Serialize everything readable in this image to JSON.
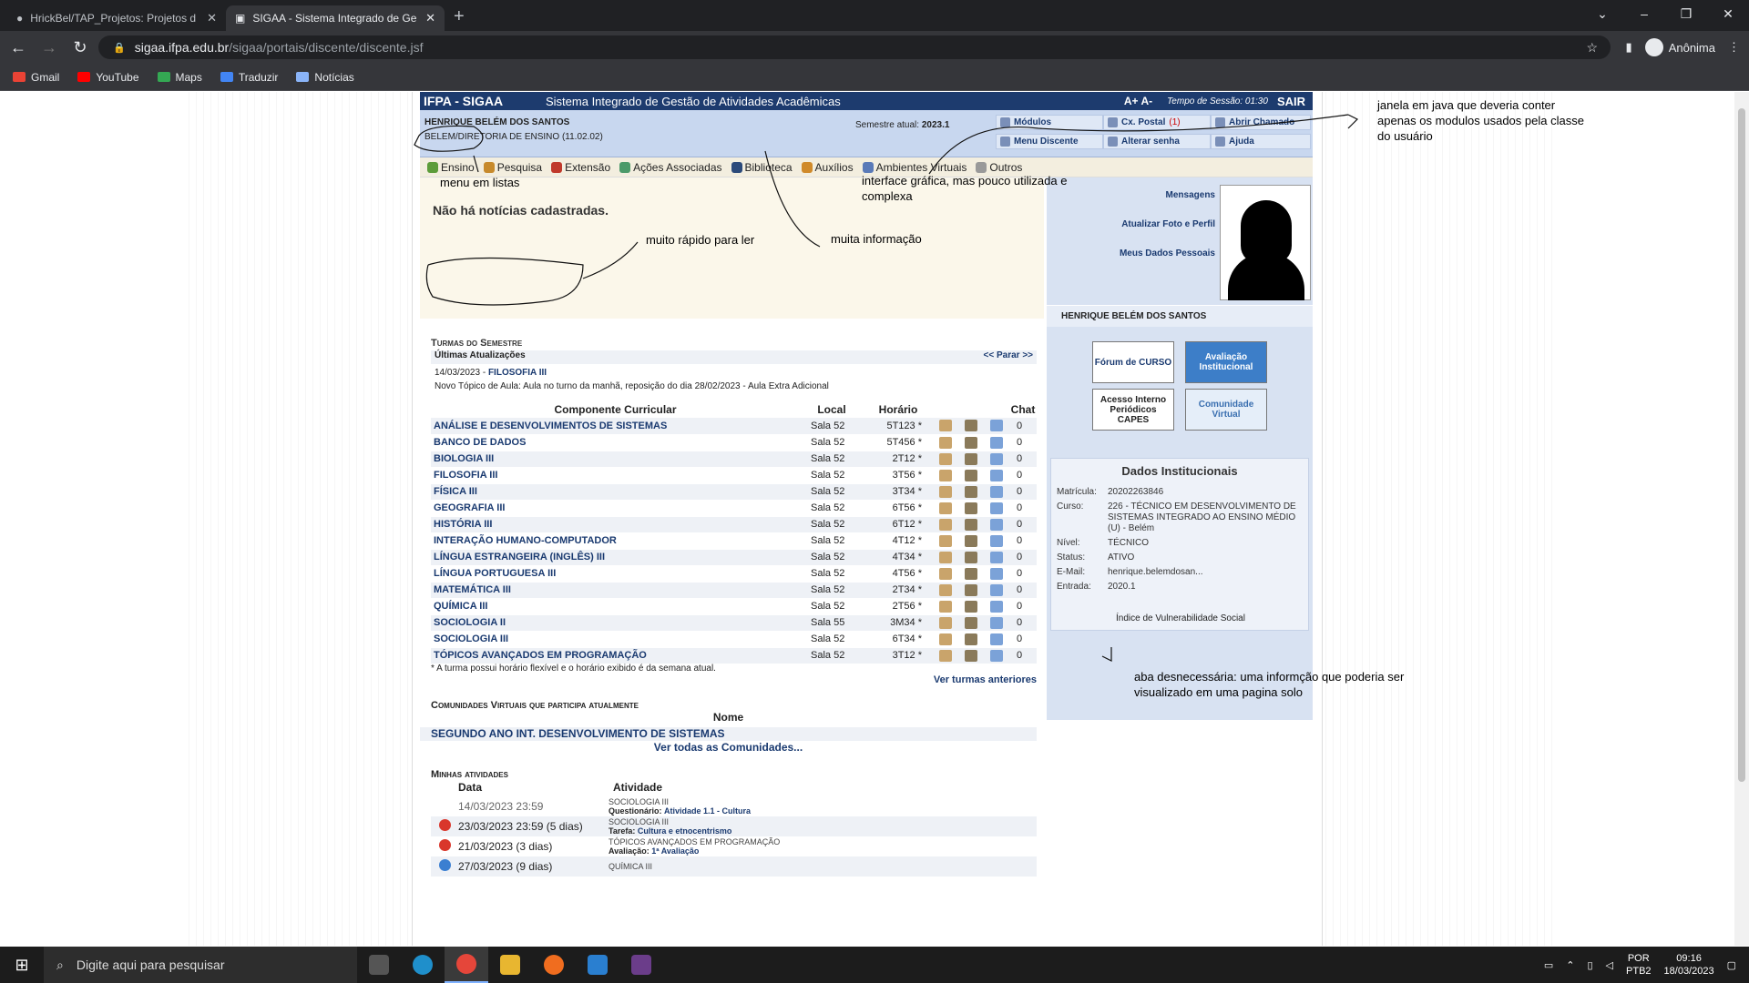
{
  "browser": {
    "tabs": [
      {
        "title": "HrickBel/TAP_Projetos: Projetos d"
      },
      {
        "title": "SIGAA - Sistema Integrado de Ge"
      }
    ],
    "url_host": "sigaa.ifpa.edu.br",
    "url_path": "/sigaa/portais/discente/discente.jsf",
    "profile": "Anônima",
    "bookmarks": [
      {
        "label": "Gmail",
        "color": "#ea4335"
      },
      {
        "label": "YouTube",
        "color": "#ff0000"
      },
      {
        "label": "Maps",
        "color": "#34a853"
      },
      {
        "label": "Traduzir",
        "color": "#4285f4"
      },
      {
        "label": "Notícias",
        "color": "#8ab4f8"
      }
    ]
  },
  "sigaa": {
    "logo": "IFPA - SIGAA",
    "system": "Sistema Integrado de Gestão de Atividades Acadêmicas",
    "font_ctrl": "A+ A-",
    "session": "Tempo de Sessão: 01:30",
    "logout": "SAIR",
    "student": "HENRIQUE BELÉM DOS SANTOS",
    "unit": "BELEM/DIRETORIA DE ENSINO (11.02.02)",
    "semester_label": "Semestre atual:",
    "semester": "2023.1",
    "quick": {
      "modulos": "Módulos",
      "caixa": "Cx. Postal",
      "caixa_count": "(1)",
      "chamado": "Abrir Chamado",
      "menu": "Menu Discente",
      "senha": "Alterar senha",
      "ajuda": "Ajuda"
    },
    "menu": [
      {
        "label": "Ensino",
        "color": "#5c9c3a"
      },
      {
        "label": "Pesquisa",
        "color": "#c78a2c"
      },
      {
        "label": "Extensão",
        "color": "#c0392b"
      },
      {
        "label": "Ações Associadas",
        "color": "#4c9a6a"
      },
      {
        "label": "Biblioteca",
        "color": "#2c4a7a"
      },
      {
        "label": "Auxílios",
        "color": "#d08a2a"
      },
      {
        "label": "Ambientes Virtuais",
        "color": "#5a7ab8"
      },
      {
        "label": "Outros",
        "color": "#999999"
      }
    ],
    "no_news": "Não há notícias cadastradas.",
    "right_links": [
      "Mensagens",
      "Atualizar Foto e Perfil",
      "Meus Dados Pessoais"
    ],
    "banners": {
      "forum": "Fórum de CURSO",
      "avaliacao": "Avaliação Institucional",
      "capes": "Acesso Interno Periódicos CAPES",
      "comunidade": "Comunidade Virtual"
    },
    "dados": {
      "title": "Dados Institucionais",
      "rows": [
        {
          "k": "Matrícula:",
          "v": "20202263846"
        },
        {
          "k": "Curso:",
          "v": "226 - TÉCNICO EM DESENVOLVIMENTO DE SISTEMAS INTEGRADO AO ENSINO MÉDIO (U) - Belém"
        },
        {
          "k": "Nível:",
          "v": "TÉCNICO"
        },
        {
          "k": "Status:",
          "v": "ATIVO"
        },
        {
          "k": "E-Mail:",
          "v": "henrique.belemdosan..."
        },
        {
          "k": "Entrada:",
          "v": "2020.1"
        }
      ],
      "ivs": "Índice de Vulnerabilidade Social"
    },
    "turmas_title": "Turmas do Semestre",
    "updates": {
      "title": "Últimas Atualizações",
      "pause": "<< Parar >>",
      "date": "14/03/2023 -",
      "course": "FILOSOFIA III",
      "desc": "Novo Tópico de Aula: Aula no turno da manhã, reposição do dia 28/02/2023 - Aula Extra Adicional"
    },
    "table": {
      "headers": [
        "Componente Curricular",
        "Local",
        "Horário",
        "Chat"
      ],
      "rows": [
        [
          "ANÁLISE E DESENVOLVIMENTOS DE SISTEMAS",
          "Sala 52",
          "5T123 *",
          "0"
        ],
        [
          "BANCO DE DADOS",
          "Sala 52",
          "5T456 *",
          "0"
        ],
        [
          "BIOLOGIA III",
          "Sala 52",
          "2T12 *",
          "0"
        ],
        [
          "FILOSOFIA III",
          "Sala 52",
          "3T56 *",
          "0"
        ],
        [
          "FÍSICA III",
          "Sala 52",
          "3T34 *",
          "0"
        ],
        [
          "GEOGRAFIA III",
          "Sala 52",
          "6T56 *",
          "0"
        ],
        [
          "HISTÓRIA III",
          "Sala 52",
          "6T12 *",
          "0"
        ],
        [
          "INTERAÇÃO HUMANO-COMPUTADOR",
          "Sala 52",
          "4T12 *",
          "0"
        ],
        [
          "LÍNGUA ESTRANGEIRA (INGLÊS) III",
          "Sala 52",
          "4T34 *",
          "0"
        ],
        [
          "LÍNGUA PORTUGUESA III",
          "Sala 52",
          "4T56 *",
          "0"
        ],
        [
          "MATEMÁTICA III",
          "Sala 52",
          "2T34 *",
          "0"
        ],
        [
          "QUÍMICA III",
          "Sala 52",
          "2T56 *",
          "0"
        ],
        [
          "SOCIOLOGIA II",
          "Sala 55",
          "3M34 *",
          "0"
        ],
        [
          "SOCIOLOGIA III",
          "Sala 52",
          "6T34 *",
          "0"
        ],
        [
          "TÓPICOS AVANÇADOS EM PROGRAMAÇÃO",
          "Sala 52",
          "3T12 *",
          "0"
        ]
      ]
    },
    "foot_note": "* A turma possui horário flexível e o horário exibido é da semana atual.",
    "prev_classes": "Ver turmas anteriores",
    "comu_title": "Comunidades Virtuais que participa atualmente",
    "comu_header": "Nome",
    "comu_item": "SEGUNDO ANO INT. DESENVOLVIMENTO DE SISTEMAS",
    "comu_all": "Ver todas as Comunidades...",
    "atv_title": "Minhas atividades",
    "atv_headers": [
      "Data",
      "Atividade"
    ],
    "atv": [
      {
        "date": "14/03/2023 23:59",
        "subject": "SOCIOLOGIA III",
        "type": "Questionário:",
        "name": "Atividade 1.1 - Cultura",
        "icon": "none"
      },
      {
        "date": "23/03/2023 23:59 (5 dias)",
        "subject": "SOCIOLOGIA III",
        "type": "Tarefa:",
        "name": "Cultura e etnocentrismo",
        "icon": "alert"
      },
      {
        "date": "21/03/2023 (3 dias)",
        "subject": "TÓPICOS AVANÇADOS EM PROGRAMAÇÃO",
        "type": "Avaliação:",
        "name": "1ª Avaliação",
        "icon": "alert"
      },
      {
        "date": "27/03/2023 (9 dias)",
        "subject": "QUÍMICA III",
        "type": "",
        "name": "",
        "icon": "info"
      }
    ]
  },
  "annotations": {
    "java": "janela em java que deveria conter apenas os modulos usados pela classe do usuário",
    "lists": "menu em listas",
    "graphic": "interface gráfica, mas pouco utilizada e complexa",
    "fast": "muito rápido para ler",
    "info": "muita informação",
    "tab": "aba desnecessária: uma informção que poderia ser visualizado em uma pagina solo"
  },
  "taskbar": {
    "search": "Digite aqui para pesquisar",
    "lang1": "POR",
    "lang2": "PTB2",
    "time": "09:16",
    "date": "18/03/2023"
  }
}
